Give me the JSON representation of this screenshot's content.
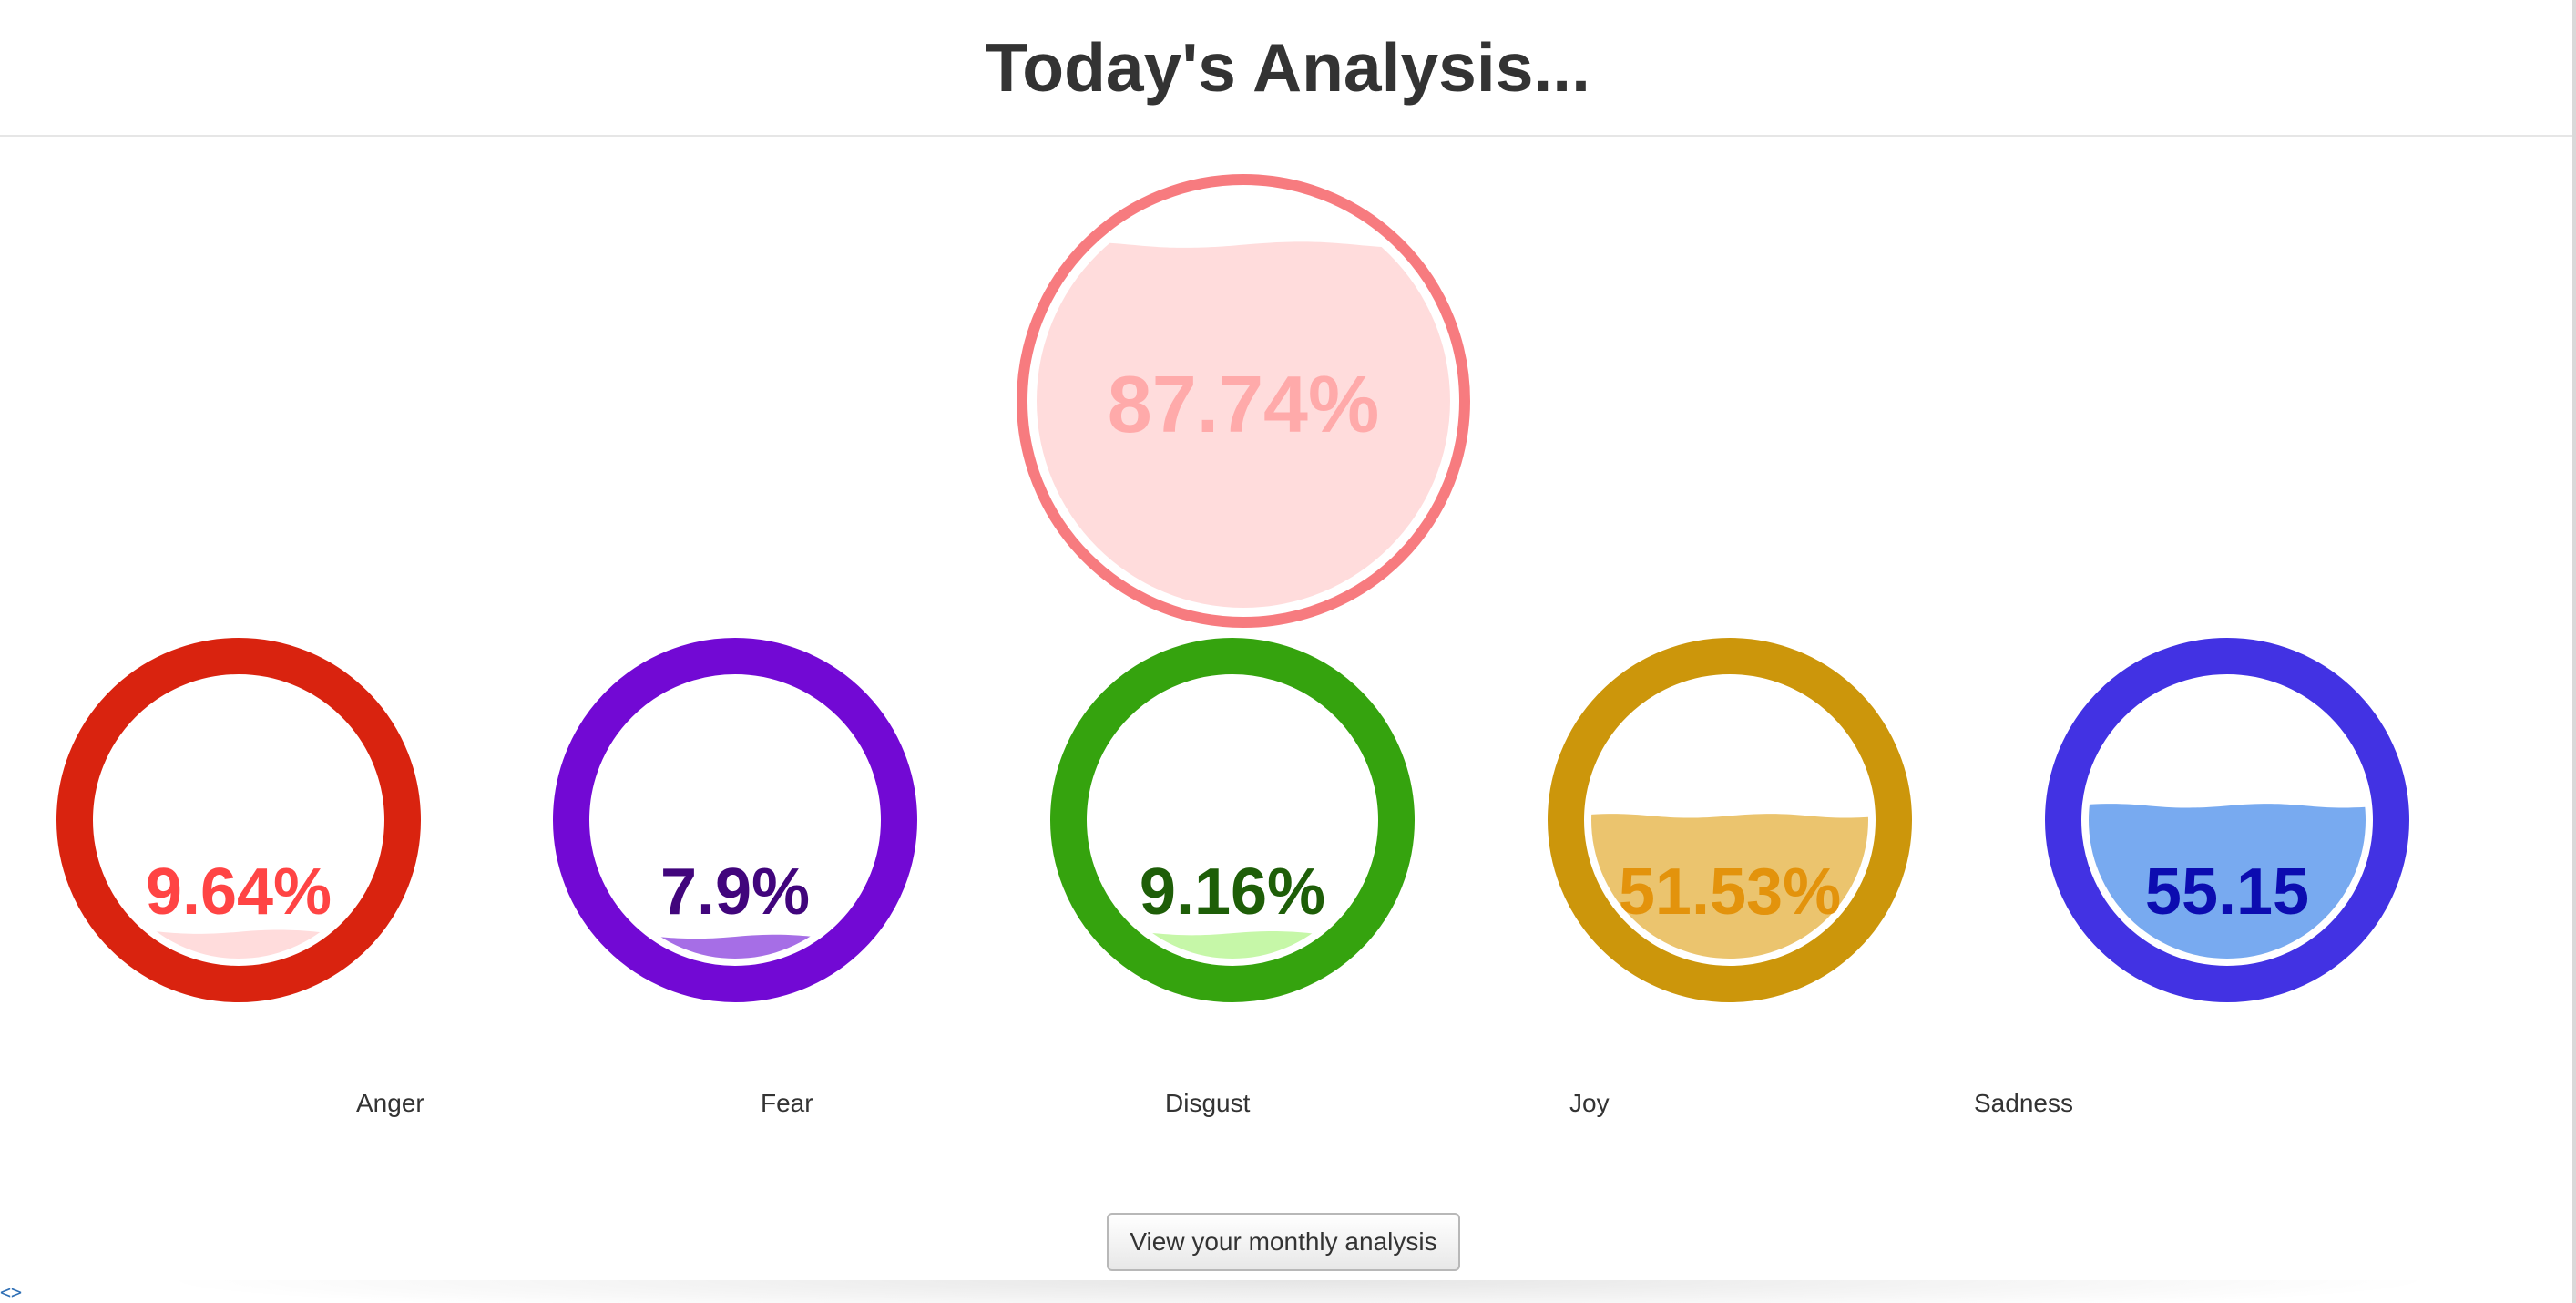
{
  "header": {
    "title": "Today's Analysis..."
  },
  "primary_gauge": {
    "text": "87.74%",
    "level": 0.8774,
    "ring_color": "#f77b7f",
    "fill_color": "#ffdcdc",
    "text_color": "#ffaaaa"
  },
  "gauges": [
    {
      "label": "Anger",
      "text": "9.64%",
      "level": 0.0964,
      "ring_color": "#d9230f",
      "fill_color": "#ffdcdc",
      "text_color": "#ff4444"
    },
    {
      "label": "Fear",
      "text": "7.9%",
      "level": 0.079,
      "ring_color": "#7209d4",
      "fill_color": "#a66ee6",
      "text_color": "#41057c"
    },
    {
      "label": "Disgust",
      "text": "9.16%",
      "level": 0.0916,
      "ring_color": "#35a30e",
      "fill_color": "#c6f7a8",
      "text_color": "#1e5e08"
    },
    {
      "label": "Joy",
      "text": "51.53%",
      "level": 0.5153,
      "ring_color": "#cc960b",
      "fill_color": "#ebc46e",
      "text_color": "#e3930c"
    },
    {
      "label": "Sadness",
      "text": "55.15",
      "level": 0.5515,
      "ring_color": "#4232e3",
      "fill_color": "#78aaf0",
      "text_color": "#0c0cb0"
    }
  ],
  "footer": {
    "monthly_button": "View your monthly analysis",
    "corner_glyph": "<>"
  }
}
